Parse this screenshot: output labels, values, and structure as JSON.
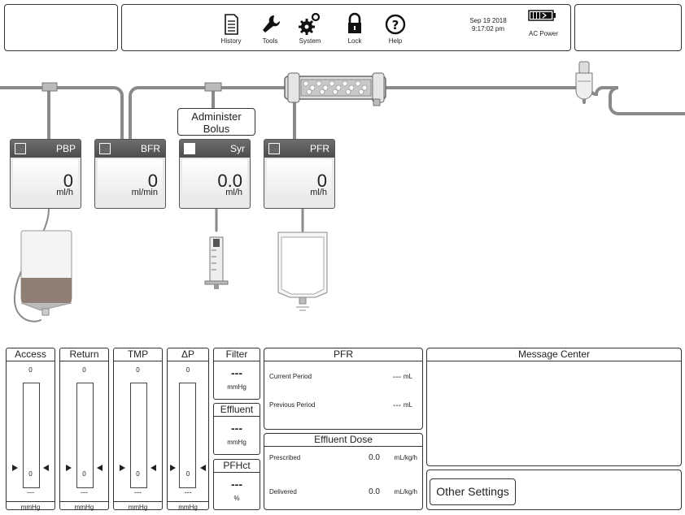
{
  "header": {
    "tools": [
      {
        "label": "History",
        "icon": "document-icon"
      },
      {
        "label": "Tools",
        "icon": "wrench-icon"
      },
      {
        "label": "System",
        "icon": "gears-icon"
      },
      {
        "label": "Lock",
        "icon": "lock-icon"
      },
      {
        "label": "Help",
        "icon": "help-icon"
      }
    ],
    "date": "Sep 19 2018",
    "time": "9:17:02 pm",
    "power_label": "AC Power"
  },
  "pumps": [
    {
      "name": "PBP",
      "value": "0",
      "unit": "ml/h"
    },
    {
      "name": "BFR",
      "value": "0",
      "unit": "ml/min"
    },
    {
      "name": "Syr",
      "value": "0.0",
      "unit": "ml/h"
    },
    {
      "name": "PFR",
      "value": "0",
      "unit": "ml/h"
    }
  ],
  "bolus_label_1": "Administer",
  "bolus_label_2": "Bolus",
  "gauges": [
    {
      "title": "Access",
      "max": "0",
      "min": "0",
      "value": "---",
      "unit": "mmHg"
    },
    {
      "title": "Return",
      "max": "0",
      "min": "0",
      "value": "---",
      "unit": "mmHg"
    },
    {
      "title": "TMP",
      "max": "0",
      "min": "0",
      "value": "---",
      "unit": "mmHg"
    },
    {
      "title": "ΔP",
      "max": "0",
      "min": "0",
      "value": "---",
      "unit": "mmHg"
    }
  ],
  "pressures": [
    {
      "title": "Filter",
      "value": "---",
      "unit": "mmHg"
    },
    {
      "title": "Effluent",
      "value": "---",
      "unit": "mmHg"
    },
    {
      "title": "PFHct",
      "value": "---",
      "unit": "%"
    }
  ],
  "pfr_panel": {
    "title": "PFR",
    "current_label": "Current Period",
    "current_value": "---",
    "current_unit": "mL",
    "previous_label": "Previous Period",
    "previous_value": "---",
    "previous_unit": "mL"
  },
  "effluent_dose": {
    "title": "Effluent Dose",
    "prescribed_label": "Prescribed",
    "prescribed_value": "0.0",
    "prescribed_unit": "mL/kg/h",
    "delivered_label": "Delivered",
    "delivered_value": "0.0",
    "delivered_unit": "mL/kg/h"
  },
  "message_center": {
    "title": "Message Center"
  },
  "other_settings_label": "Other Settings"
}
